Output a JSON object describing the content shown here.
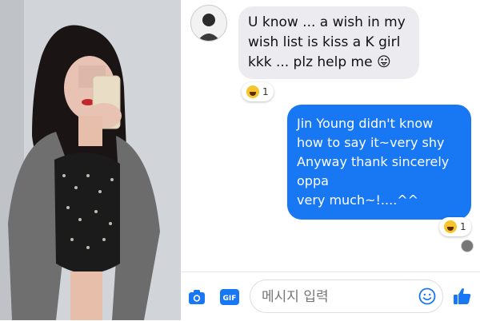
{
  "incoming_message": {
    "text_line1": "U know ... a wish in my",
    "text_line2": "wish list is kiss a K girl",
    "text_line3": "kkk ... plz help me 😛",
    "reaction_count": "1"
  },
  "outgoing_message": {
    "line1": "Jin Young didn't know",
    "line2": "how to say it~very shy",
    "line3": "Anyway thank sincerely",
    "line4": "oppa",
    "line5": "very much~!....^^",
    "reaction_count": "1"
  },
  "composer": {
    "placeholder": "메시지 입력",
    "gif_label": "GIF"
  },
  "colors": {
    "brand_blue": "#1877f2",
    "incoming_bubble": "#ececf0"
  },
  "icons": {
    "camera": "camera-icon",
    "gif": "gif-icon",
    "emoji": "emoji-icon",
    "like": "thumbs-up-icon"
  }
}
